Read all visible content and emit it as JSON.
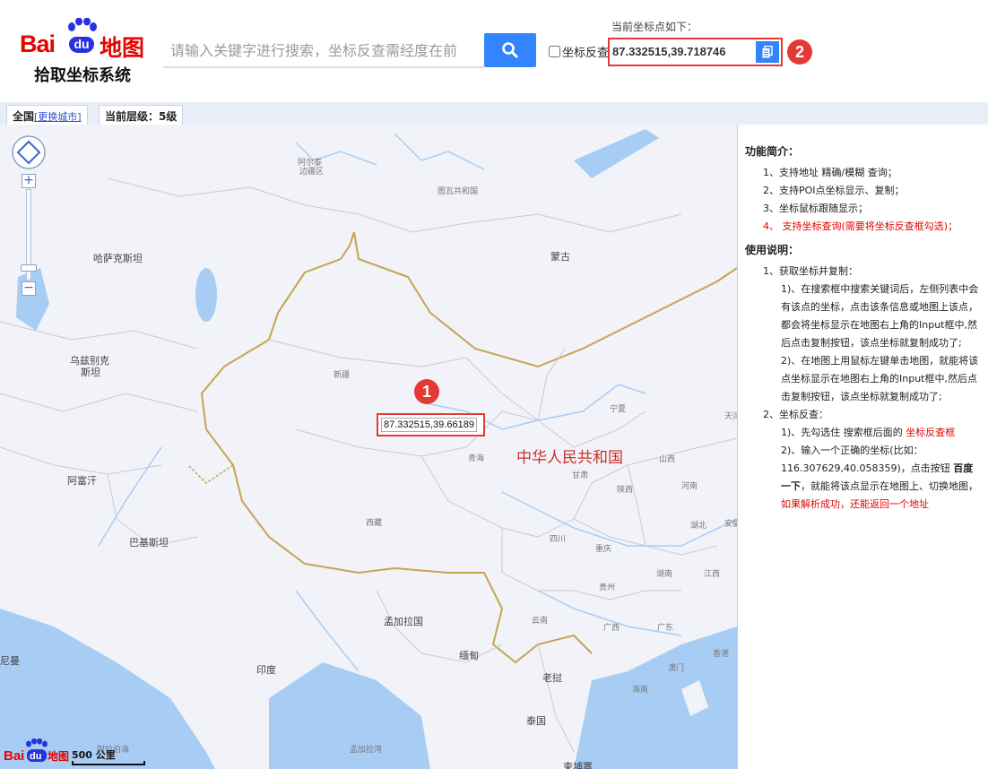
{
  "header": {
    "logo_brand_bai": "Bai",
    "logo_brand_du": "du",
    "logo_map": "地图",
    "logo_subtitle": "拾取坐标系统",
    "search_placeholder": "请输入关键字进行搜索，坐标反查需经度在前",
    "reverse_label": "坐标反查",
    "coord_caption": "当前坐标点如下：",
    "coord_value": "87.332515,39.718746",
    "badge_top": "2"
  },
  "tabs": {
    "city": "全国",
    "change_city": "[更换城市]",
    "level": "当前层级：5级"
  },
  "map": {
    "coord_popup": "87.332515,39.66189",
    "badge_popup": "1",
    "country_label": "中华人民共和国",
    "labels": [
      {
        "text": "阿尔泰",
        "cls": "small"
      },
      {
        "text": "边疆区",
        "cls": "small"
      },
      {
        "text": "图瓦共和国",
        "cls": "small"
      },
      {
        "text": "哈萨克斯坦",
        "cls": ""
      },
      {
        "text": "蒙古",
        "cls": ""
      },
      {
        "text": "乌兹别克",
        "cls": ""
      },
      {
        "text": "斯坦",
        "cls": ""
      },
      {
        "text": "新疆",
        "cls": "small"
      },
      {
        "text": "宁夏",
        "cls": "small"
      },
      {
        "text": "青海",
        "cls": "small"
      },
      {
        "text": "甘肃",
        "cls": "small"
      },
      {
        "text": "山西",
        "cls": "small"
      },
      {
        "text": "陕西",
        "cls": "small"
      },
      {
        "text": "河南",
        "cls": "small"
      },
      {
        "text": "阿富汗",
        "cls": ""
      },
      {
        "text": "西藏",
        "cls": "small"
      },
      {
        "text": "四川",
        "cls": "small"
      },
      {
        "text": "湖北",
        "cls": "small"
      },
      {
        "text": "巴基斯坦",
        "cls": ""
      },
      {
        "text": "重庆",
        "cls": "small"
      },
      {
        "text": "湖南",
        "cls": "small"
      },
      {
        "text": "江西",
        "cls": "small"
      },
      {
        "text": "贵州",
        "cls": "small"
      },
      {
        "text": "孟加拉国",
        "cls": ""
      },
      {
        "text": "云南",
        "cls": "small"
      },
      {
        "text": "广西",
        "cls": "small"
      },
      {
        "text": "广东",
        "cls": "small"
      },
      {
        "text": "缅甸",
        "cls": ""
      },
      {
        "text": "印度",
        "cls": ""
      },
      {
        "text": "老挝",
        "cls": ""
      },
      {
        "text": "澳门",
        "cls": "small"
      },
      {
        "text": "香港",
        "cls": "small"
      },
      {
        "text": "海南",
        "cls": "small"
      },
      {
        "text": "泰国",
        "cls": ""
      },
      {
        "text": "孟加拉湾",
        "cls": "small"
      },
      {
        "text": "柬埔寨",
        "cls": ""
      },
      {
        "text": "阿拉伯海",
        "cls": "small"
      },
      {
        "text": "尼曼",
        "cls": ""
      },
      {
        "text": "安徽",
        "cls": "small"
      },
      {
        "text": "天津",
        "cls": "small"
      }
    ],
    "scale": "500 公里",
    "map_logo": "Bai地图"
  },
  "sidebar": {
    "intro_title": "功能简介：",
    "intro": [
      "1、支持地址 精确/模糊 查询；",
      "2、支持POI点坐标显示、复制；",
      "3、坐标鼠标跟随显示；",
      "4、 支持坐标查询(需要将坐标反查框勾选)；"
    ],
    "usage_title": "使用说明：",
    "step1": "1、获取坐标并复制：",
    "step1_a": "1)、在搜索框中搜索关键词后，左侧列表中会有该点的坐标，点击该条信息或地图上该点，都会将坐标显示在地图右上角的Input框中,然后点击复制按钮，该点坐标就复制成功了;",
    "step1_b": "2)、在地图上用鼠标左键单击地图，就能将该点坐标显示在地图右上角的Input框中,然后点击复制按钮，该点坐标就复制成功了;",
    "step2": "2、坐标反查：",
    "step2_a_1": "1)、先勾选住 搜索框后面的 ",
    "step2_a_2": "坐标反查框",
    "step2_b_1": "2)、输入一个正确的坐标(比如：116.307629,40.058359)，点击按钮 ",
    "step2_b_2": "百度一下",
    "step2_b_3": "，就能将该点显示在地图上、切换地图，",
    "step2_b_4": "如果解析成功，还能返回一个地址"
  }
}
